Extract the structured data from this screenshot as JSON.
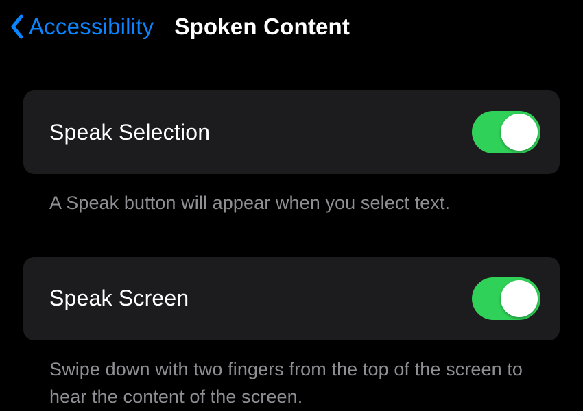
{
  "header": {
    "back_label": "Accessibility",
    "title": "Spoken Content"
  },
  "settings": {
    "speak_selection": {
      "label": "Speak Selection",
      "description": "A Speak button will appear when you select text.",
      "enabled": true
    },
    "speak_screen": {
      "label": "Speak Screen",
      "description": "Swipe down with two fingers from the top of the screen to hear the content of the screen.",
      "enabled": true
    }
  }
}
